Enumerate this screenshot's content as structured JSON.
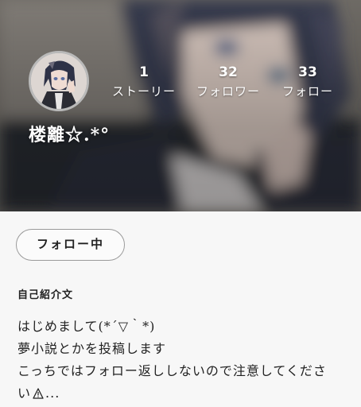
{
  "profile": {
    "username": "楼離☆.*°",
    "stats": [
      {
        "count": "1",
        "label": "ストーリー"
      },
      {
        "count": "32",
        "label": "フォロワー"
      },
      {
        "count": "33",
        "label": "フォロー"
      }
    ],
    "follow_button_label": "フォロー中",
    "avatar_icon": "avatar-image",
    "cover_icon": "cover-image"
  },
  "bio": {
    "heading": "自己紹介文",
    "lines": [
      "はじめまして(*´▽｀*)",
      "夢小説とかを投稿します",
      "こっちではフォロー返ししないので注意してくださ",
      "い"
    ],
    "line4_suffix": "...",
    "warning_icon": "warning-icon"
  },
  "colors": {
    "header_bg": "#2c2f37",
    "page_bg": "#f7f7f7",
    "text": "#222222",
    "button_border": "#9a9a9a",
    "warning": "#222222"
  }
}
